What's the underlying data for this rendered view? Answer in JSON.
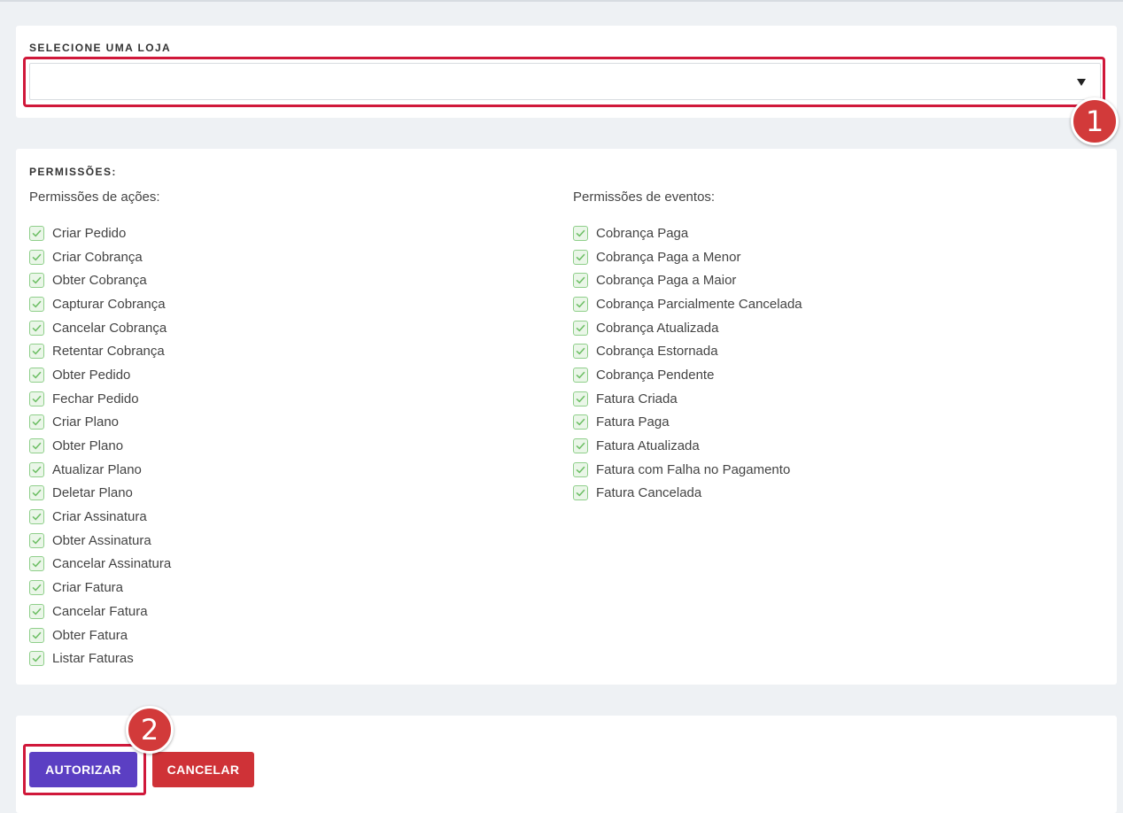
{
  "store_section": {
    "label": "SELECIONE UMA LOJA",
    "selected_value": "",
    "callout_number": "1"
  },
  "permissions": {
    "label": "PERMISSÕES:",
    "actions": {
      "title": "Permissões de ações:",
      "items": [
        {
          "label": "Criar Pedido",
          "checked": true
        },
        {
          "label": "Criar Cobrança",
          "checked": true
        },
        {
          "label": "Obter Cobrança",
          "checked": true
        },
        {
          "label": "Capturar Cobrança",
          "checked": true
        },
        {
          "label": "Cancelar Cobrança",
          "checked": true
        },
        {
          "label": "Retentar Cobrança",
          "checked": true
        },
        {
          "label": "Obter Pedido",
          "checked": true
        },
        {
          "label": "Fechar Pedido",
          "checked": true
        },
        {
          "label": "Criar Plano",
          "checked": true
        },
        {
          "label": "Obter Plano",
          "checked": true
        },
        {
          "label": "Atualizar Plano",
          "checked": true
        },
        {
          "label": "Deletar Plano",
          "checked": true
        },
        {
          "label": "Criar Assinatura",
          "checked": true
        },
        {
          "label": "Obter Assinatura",
          "checked": true
        },
        {
          "label": "Cancelar Assinatura",
          "checked": true
        },
        {
          "label": "Criar Fatura",
          "checked": true
        },
        {
          "label": "Cancelar Fatura",
          "checked": true
        },
        {
          "label": "Obter Fatura",
          "checked": true
        },
        {
          "label": "Listar Faturas",
          "checked": true
        }
      ]
    },
    "events": {
      "title": "Permissões de eventos:",
      "items": [
        {
          "label": "Cobrança Paga",
          "checked": true
        },
        {
          "label": "Cobrança Paga a Menor",
          "checked": true
        },
        {
          "label": "Cobrança Paga a Maior",
          "checked": true
        },
        {
          "label": "Cobrança Parcialmente Cancelada",
          "checked": true
        },
        {
          "label": "Cobrança Atualizada",
          "checked": true
        },
        {
          "label": "Cobrança Estornada",
          "checked": true
        },
        {
          "label": "Cobrança Pendente",
          "checked": true
        },
        {
          "label": "Fatura Criada",
          "checked": true
        },
        {
          "label": "Fatura Paga",
          "checked": true
        },
        {
          "label": "Fatura Atualizada",
          "checked": true
        },
        {
          "label": "Fatura com Falha no Pagamento",
          "checked": true
        },
        {
          "label": "Fatura Cancelada",
          "checked": true
        }
      ]
    }
  },
  "actions_bar": {
    "authorize_label": "AUTORIZAR",
    "cancel_label": "CANCELAR",
    "callout_number": "2"
  },
  "colors": {
    "authorize": "#5b3fc3",
    "cancel": "#cf3237",
    "highlight": "#d0183a",
    "callout": "#d23a3a",
    "checkbox_border": "#8fcf8a"
  },
  "icons": {
    "select_arrow": "caret-down-icon",
    "checkbox": "checkmark-icon"
  }
}
